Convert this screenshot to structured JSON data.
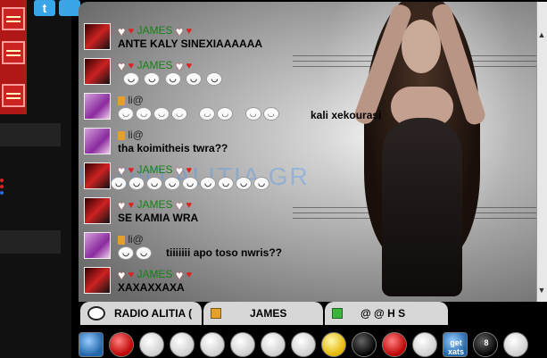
{
  "sidebar": {
    "twitter_label": "t"
  },
  "chat": {
    "watermark": "RADIO ALITIA GR",
    "messages": [
      {
        "type": "male",
        "nick": "JAMES",
        "text": "ANTE KALY SINEXIAAAAAA"
      },
      {
        "type": "male",
        "nick": "JAMES",
        "text": ""
      },
      {
        "type": "female",
        "nick": "li@",
        "text": "kali xekourasi"
      },
      {
        "type": "female",
        "nick": "li@",
        "text": "tha koimitheis twra??"
      },
      {
        "type": "male",
        "nick": "JAMES",
        "text": ""
      },
      {
        "type": "male",
        "nick": "JAMES",
        "text": "SE KAMIA WRA"
      },
      {
        "type": "female",
        "nick": "li@",
        "text": "tiiiiiii apo toso nwris??"
      },
      {
        "type": "male",
        "nick": "JAMES",
        "text": "XAXAXXAXA"
      }
    ]
  },
  "tabs": [
    {
      "label": "RADIO ALITIA ("
    },
    {
      "label": "JAMES"
    },
    {
      "label": "@ @ H S"
    }
  ],
  "scroll": {
    "up": "▲",
    "down": "▼"
  },
  "emoticons": [
    {
      "name": "party-emoticon",
      "style": "blue",
      "label": ""
    },
    {
      "name": "kiss-emoticon",
      "style": "red",
      "label": ""
    },
    {
      "name": "smile-emoticon",
      "style": "",
      "label": ""
    },
    {
      "name": "wink-emoticon",
      "style": "",
      "label": ""
    },
    {
      "name": "big-grin-emoticon",
      "style": "",
      "label": ""
    },
    {
      "name": "laugh-emoticon",
      "style": "",
      "label": ""
    },
    {
      "name": "nerd-emoticon",
      "style": "",
      "label": ""
    },
    {
      "name": "tongue-emoticon",
      "style": "",
      "label": ""
    },
    {
      "name": "beer-emoticon",
      "style": "yellow",
      "label": ""
    },
    {
      "name": "dance-emoticon",
      "style": "black",
      "label": ""
    },
    {
      "name": "devil-emoticon",
      "style": "red",
      "label": ""
    },
    {
      "name": "scared-emoticon",
      "style": "",
      "label": ""
    },
    {
      "name": "get-xats-emoticon",
      "style": "blue",
      "label": "get xats"
    },
    {
      "name": "eight-ball-emoticon",
      "style": "black",
      "label": "8"
    },
    {
      "name": "no-sound-emoticon",
      "style": "",
      "label": ""
    }
  ]
}
